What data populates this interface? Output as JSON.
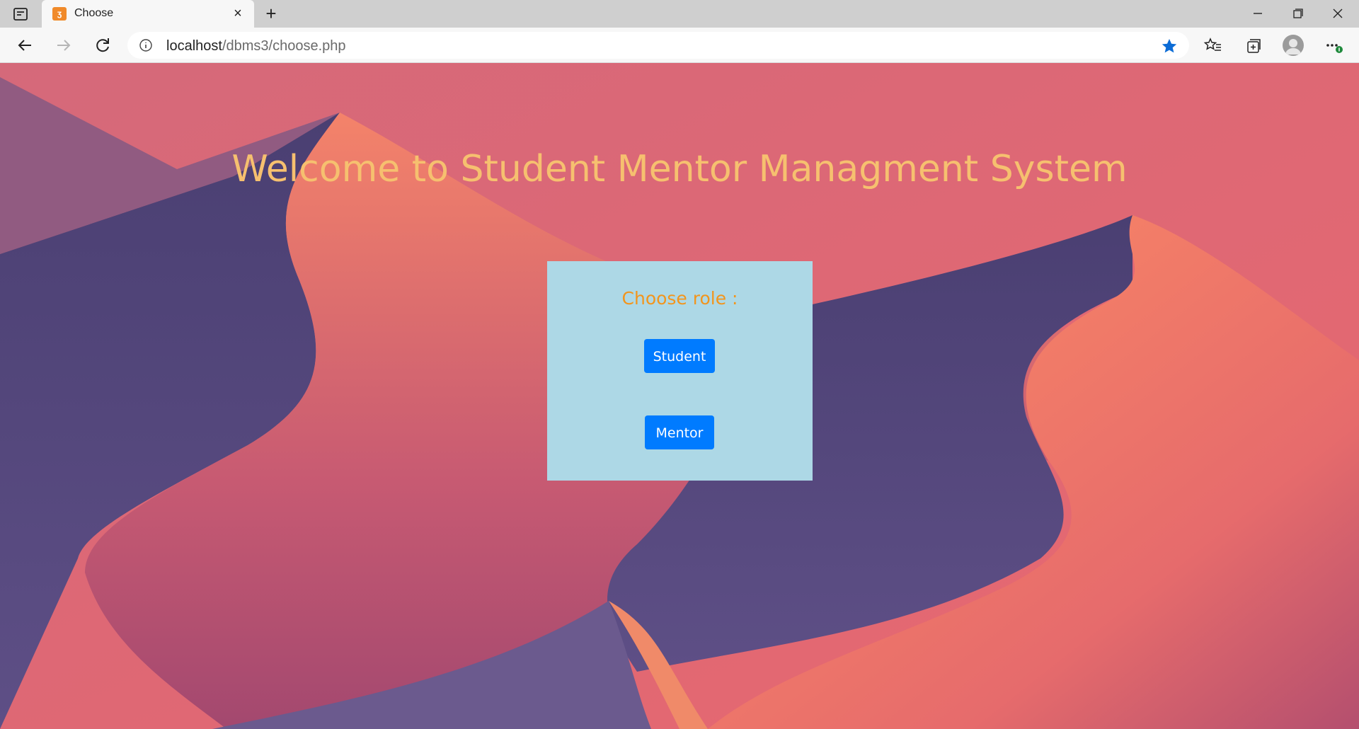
{
  "browser": {
    "tab_title": "Choose",
    "tab_close": "×",
    "new_tab": "+",
    "url_host": "localhost",
    "url_path": "/dbms3/choose.php",
    "icons": [
      "tab-actions-icon",
      "xampp-favicon",
      "close-icon",
      "plus-icon",
      "minimize-icon",
      "restore-icon",
      "window-close-icon",
      "back-icon",
      "forward-icon",
      "reload-icon",
      "info-icon",
      "star-icon",
      "favorites-icon",
      "collections-icon",
      "avatar",
      "more-icon"
    ],
    "accent": "#0c6cd6"
  },
  "page": {
    "heading": "Welcome to Student Mentor Managment System",
    "prompt": "Choose role :",
    "buttons": {
      "student": "Student",
      "mentor": "Mentor"
    },
    "colors": {
      "heading": "#f6c06f",
      "prompt": "#f2951d",
      "panel": "#add8e6",
      "button": "#007bff"
    }
  }
}
